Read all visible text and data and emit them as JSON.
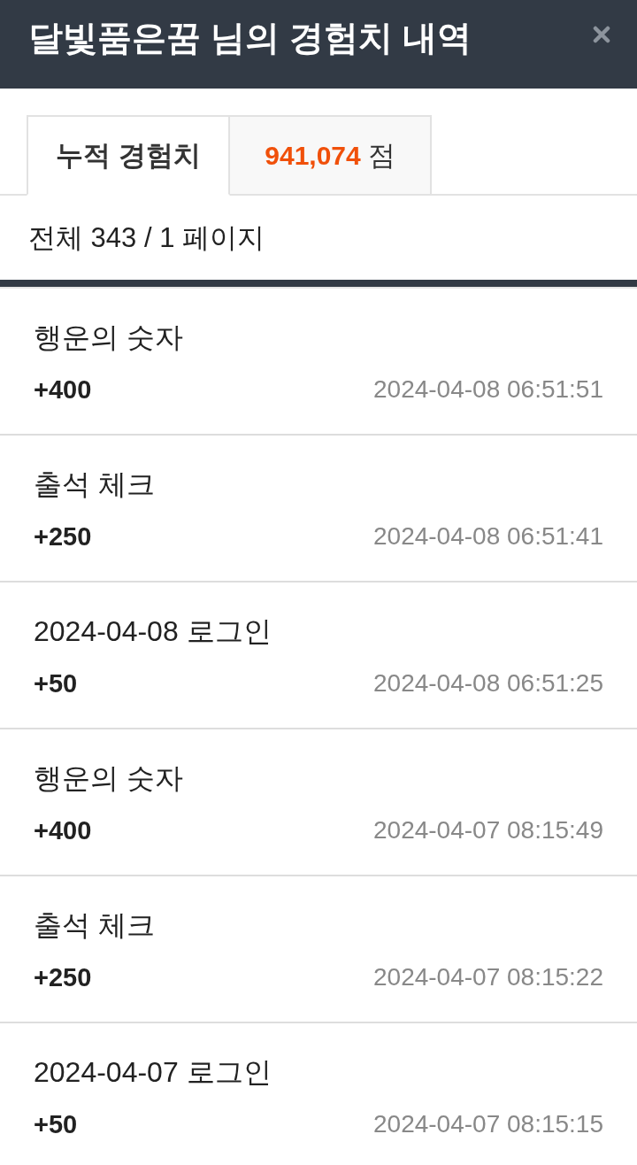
{
  "header": {
    "title": "달빛품은꿈 님의 경험치 내역"
  },
  "tabs": [
    {
      "label": "누적 경험치",
      "selected": true
    },
    {
      "value": "941,074",
      "unit": "점",
      "selected": false
    }
  ],
  "summary": {
    "text": "전체 343 / 1 페이지"
  },
  "entries": [
    {
      "title": "행운의 숫자",
      "points": "+400",
      "time": "2024-04-08 06:51:51"
    },
    {
      "title": "출석 체크",
      "points": "+250",
      "time": "2024-04-08 06:51:41"
    },
    {
      "title": "2024-04-08 로그인",
      "points": "+50",
      "time": "2024-04-08 06:51:25"
    },
    {
      "title": "행운의 숫자",
      "points": "+400",
      "time": "2024-04-07 08:15:49"
    },
    {
      "title": "출석 체크",
      "points": "+250",
      "time": "2024-04-07 08:15:22"
    },
    {
      "title": "2024-04-07 로그인",
      "points": "+50",
      "time": "2024-04-07 08:15:15"
    }
  ]
}
